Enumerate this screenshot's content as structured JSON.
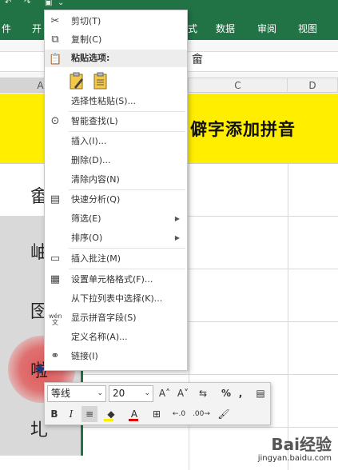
{
  "ribbon": {
    "tabs": [
      "件",
      "开",
      "式",
      "数据",
      "审阅",
      "视图"
    ]
  },
  "formula_bar": {
    "content": "畲"
  },
  "columns": [
    "A",
    "C",
    "D"
  ],
  "banner": {
    "text": "僻字添加拼音"
  },
  "cells": [
    "畬",
    "岫",
    "囹",
    "啦",
    "圠"
  ],
  "context_menu": {
    "cut": "剪切(T)",
    "copy": "复制(C)",
    "paste_options": "粘贴选项:",
    "paste_special": "选择性粘贴(S)...",
    "smart_lookup": "智能查找(L)",
    "insert": "插入(I)...",
    "delete": "删除(D)...",
    "clear_contents": "清除内容(N)",
    "quick_analysis": "快速分析(Q)",
    "filter": "筛选(E)",
    "sort": "排序(O)",
    "insert_comment": "插入批注(M)",
    "format_cells": "设置单元格格式(F)...",
    "pick_from_list": "从下拉列表中选择(K)...",
    "show_phonetic": "显示拼音字段(S)",
    "define_name": "定义名称(A)...",
    "link": "链接(I)"
  },
  "mini_toolbar": {
    "font_name": "等线",
    "font_size": "20",
    "bold": "B",
    "italic": "I",
    "percent": "%",
    "comma": ","
  },
  "watermark": {
    "brand": "Bai经验",
    "url": "jingyan.baidu.com"
  },
  "colors": {
    "ribbon": "#217346",
    "banner": "#ffee00",
    "font_color": "#e00000",
    "highlight": "#ffee00"
  }
}
